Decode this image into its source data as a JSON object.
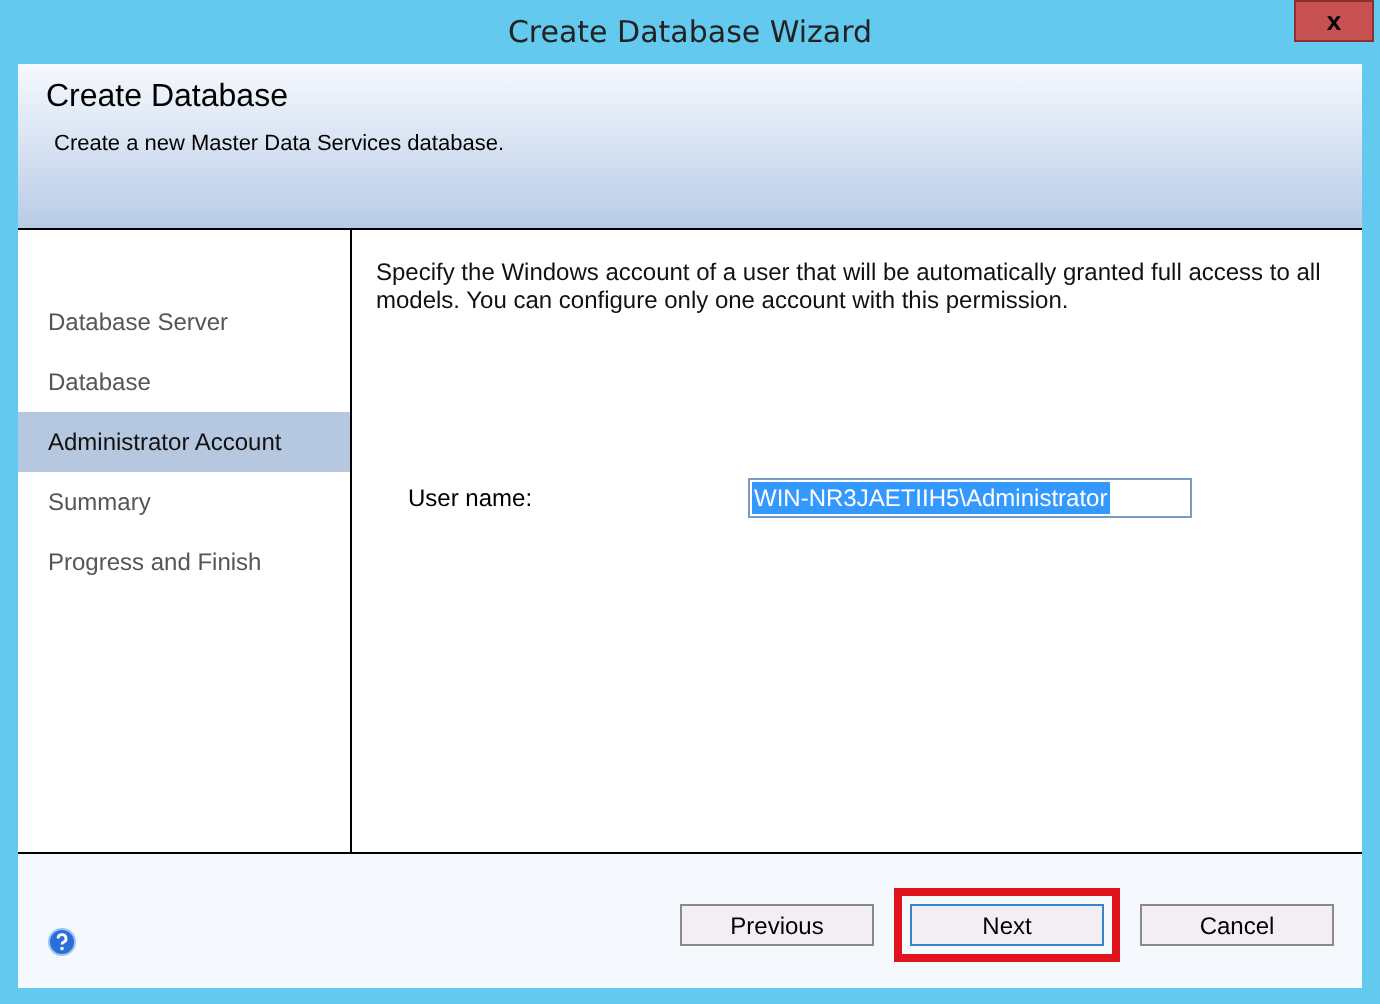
{
  "window": {
    "title": "Create Database Wizard",
    "close": "x"
  },
  "header": {
    "title": "Create Database",
    "subtitle": "Create a new Master Data Services database."
  },
  "steps": [
    {
      "label": "Database Server",
      "selected": false
    },
    {
      "label": "Database",
      "selected": false
    },
    {
      "label": "Administrator Account",
      "selected": true
    },
    {
      "label": "Summary",
      "selected": false
    },
    {
      "label": "Progress and Finish",
      "selected": false
    }
  ],
  "content": {
    "description": "Specify the Windows account of a user that will be automatically granted full access to all models. You can configure only one account with this permission.",
    "user_name": {
      "label": "User name:",
      "value": "WIN-NR3JAETIIH5\\Administrator",
      "selected": true
    }
  },
  "buttons": [
    {
      "label": "Previous",
      "highlighted": false
    },
    {
      "label": "Next",
      "highlighted": true
    },
    {
      "label": "Cancel",
      "highlighted": false
    }
  ]
}
